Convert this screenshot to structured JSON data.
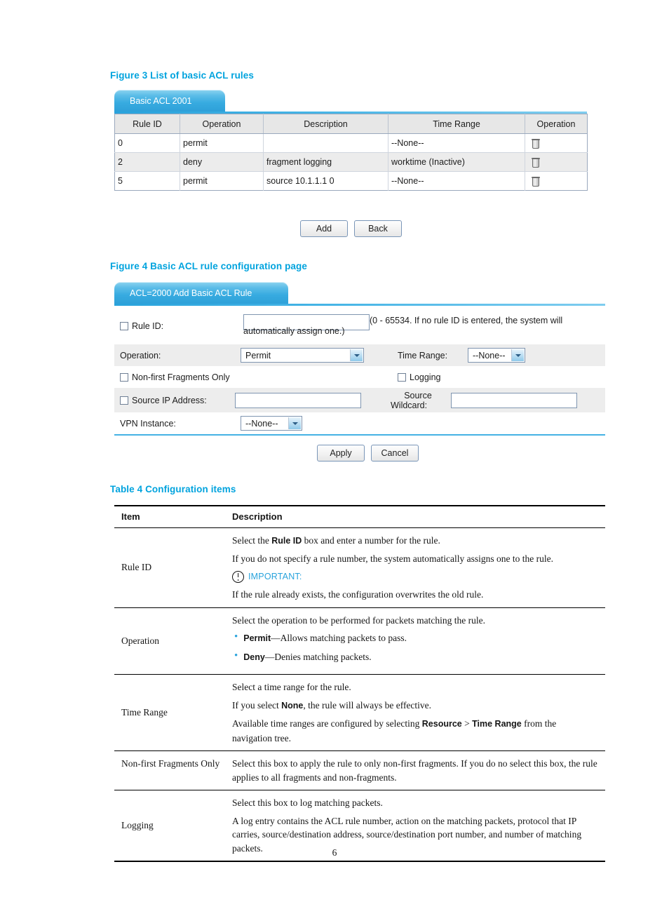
{
  "figure3": {
    "caption": "Figure 3 List of basic ACL rules",
    "tab_label": "Basic ACL 2001",
    "columns": [
      "Rule ID",
      "Operation",
      "Description",
      "Time Range",
      "Operation"
    ],
    "rows": [
      {
        "rule_id": "0",
        "operation": "permit",
        "description": "",
        "time_range": "--None--",
        "action_icon": "trash-icon"
      },
      {
        "rule_id": "2",
        "operation": "deny",
        "description": "fragment logging",
        "time_range": "worktime (Inactive)",
        "action_icon": "trash-icon"
      },
      {
        "rule_id": "5",
        "operation": "permit",
        "description": "source 10.1.1.1 0",
        "time_range": "--None--",
        "action_icon": "trash-icon"
      }
    ],
    "buttons": {
      "add": "Add",
      "back": "Back"
    }
  },
  "figure4": {
    "caption": "Figure 4 Basic ACL rule configuration page",
    "tab_label": "ACL=2000 Add Basic ACL Rule",
    "fields": {
      "rule_id_label": "Rule ID:",
      "rule_id_value": "",
      "rule_id_hint": "(0 - 65534. If no rule ID is entered, the system will automatically assign one.)",
      "operation_label": "Operation:",
      "operation_value": "Permit",
      "time_range_label": "Time Range:",
      "time_range_value": "--None--",
      "non_first_fragments_label": "Non-first Fragments Only",
      "logging_label": "Logging",
      "source_ip_label": "Source IP Address:",
      "source_ip_value": "",
      "source_wildcard_label_line1": "Source",
      "source_wildcard_label_line2": "Wildcard:",
      "source_wildcard_value": "",
      "vpn_instance_label": "VPN Instance:",
      "vpn_instance_value": "--None--"
    },
    "buttons": {
      "apply": "Apply",
      "cancel": "Cancel"
    }
  },
  "table4": {
    "caption": "Table 4 Configuration items",
    "headers": {
      "item": "Item",
      "description": "Description"
    },
    "rows": [
      {
        "item": "Rule ID",
        "lines": [
          {
            "type": "rich",
            "parts": [
              {
                "t": "Select the "
              },
              {
                "t": "Rule ID",
                "b": true
              },
              {
                "t": " box and enter a number for the rule."
              }
            ]
          },
          {
            "type": "rich",
            "parts": [
              {
                "t": "If you do not specify a rule number, the system automatically assigns one to the rule."
              }
            ]
          },
          {
            "type": "important",
            "text": "IMPORTANT:"
          },
          {
            "type": "rich",
            "parts": [
              {
                "t": "If the rule already exists, the configuration overwrites the old rule."
              }
            ]
          }
        ]
      },
      {
        "item": "Operation",
        "lines": [
          {
            "type": "rich",
            "parts": [
              {
                "t": "Select the operation to be performed for packets matching the rule."
              }
            ]
          },
          {
            "type": "bullet",
            "parts": [
              {
                "t": "Permit",
                "b": true
              },
              {
                "t": "—Allows matching packets to pass."
              }
            ]
          },
          {
            "type": "bullet",
            "parts": [
              {
                "t": "Deny",
                "b": true
              },
              {
                "t": "—Denies matching packets."
              }
            ]
          }
        ]
      },
      {
        "item": "Time Range",
        "lines": [
          {
            "type": "rich",
            "parts": [
              {
                "t": "Select a time range for the rule."
              }
            ]
          },
          {
            "type": "rich",
            "parts": [
              {
                "t": "If you select "
              },
              {
                "t": "None",
                "b": true
              },
              {
                "t": ", the rule will always be effective."
              }
            ]
          },
          {
            "type": "rich",
            "parts": [
              {
                "t": "Available time ranges are configured by selecting "
              },
              {
                "t": "Resource",
                "b": true
              },
              {
                "t": " > "
              },
              {
                "t": "Time Range",
                "b": true
              },
              {
                "t": " from the navigation tree."
              }
            ]
          }
        ]
      },
      {
        "item": "Non-first Fragments Only",
        "lines": [
          {
            "type": "rich",
            "parts": [
              {
                "t": "Select this box to apply the rule to only non-first fragments. If you do no select this box, the rule applies to all fragments and non-fragments."
              }
            ]
          }
        ]
      },
      {
        "item": "Logging",
        "lines": [
          {
            "type": "rich",
            "parts": [
              {
                "t": "Select this box to log matching packets."
              }
            ]
          },
          {
            "type": "rich",
            "parts": [
              {
                "t": "A log entry contains the ACL rule number, action on the matching packets, protocol that IP carries, source/destination address, source/destination port number, and number of matching packets."
              }
            ]
          }
        ]
      }
    ]
  },
  "footer": {
    "page_number": "6"
  },
  "colors": {
    "accent": "#00a3de",
    "tab_blue": "#37abe0",
    "bullet": "#29a3dc"
  }
}
